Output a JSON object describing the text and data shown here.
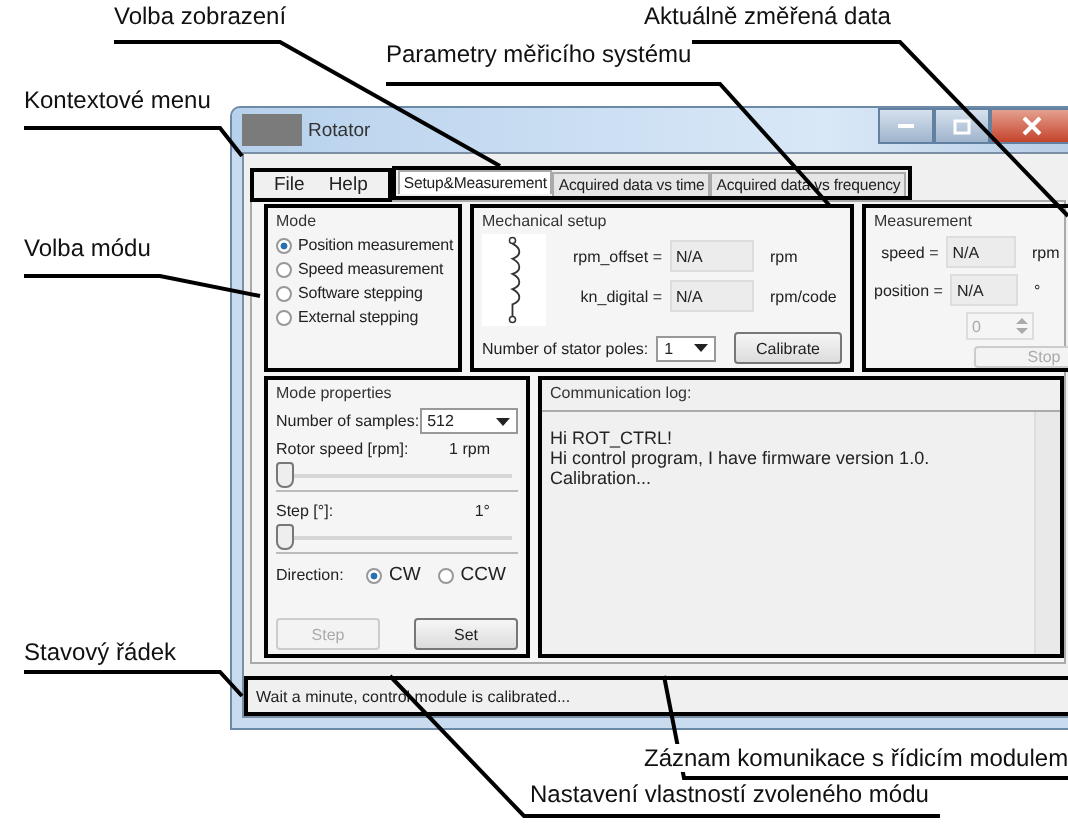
{
  "annotations": [
    {
      "text": "Volba zobrazení"
    },
    {
      "text": "Aktuálně změřená data"
    },
    {
      "text": "Parametry měřicího systému"
    },
    {
      "text": "Kontextové menu"
    },
    {
      "text": "Volba módu"
    },
    {
      "text": "Stavový řádek"
    },
    {
      "text": "Záznam komunikace s řídicím modulem"
    },
    {
      "text": "Nastavení vlastností zvoleného módu"
    }
  ],
  "window": {
    "title": "Rotator"
  },
  "menu": [
    "File",
    "Help"
  ],
  "tabs": [
    {
      "label": "Setup&Measurement",
      "selected": true
    },
    {
      "label": "Acquired data vs time",
      "selected": false
    },
    {
      "label": "Acquired data vs frequency",
      "selected": false
    }
  ],
  "mode": {
    "title": "Mode",
    "options": [
      {
        "label": "Position measurement",
        "selected": true
      },
      {
        "label": "Speed measurement",
        "selected": false
      },
      {
        "label": "Software stepping",
        "selected": false
      },
      {
        "label": "External stepping",
        "selected": false
      }
    ]
  },
  "mechanical": {
    "title": "Mechanical setup",
    "fields": [
      {
        "label": "rpm_offset =",
        "value": "N/A",
        "unit": "rpm"
      },
      {
        "label": "kn_digital =",
        "value": "N/A",
        "unit": "rpm/code"
      }
    ],
    "poles_label": "Number of stator poles:",
    "poles_value": "1",
    "button": "Calibrate"
  },
  "measurement": {
    "title": "Measurement",
    "fields": [
      {
        "label": "speed =",
        "value": "N/A",
        "unit": "rpm"
      },
      {
        "label": "position =",
        "value": "N/A",
        "unit": "°"
      }
    ],
    "spinner": "0",
    "button": {
      "label": "Stop",
      "disabled": true
    }
  },
  "mode_properties": {
    "title": "Mode properties",
    "samples_label": "Number of samples:",
    "samples_value": "512",
    "sliders": [
      {
        "label": "Rotor speed [rpm]:",
        "reading": "1 rpm",
        "level": 0
      },
      {
        "label": "Step [°]:",
        "reading": "1°",
        "level": 0
      }
    ],
    "direction_label": "Direction:",
    "directions": [
      {
        "label": "CW",
        "selected": true
      },
      {
        "label": "CCW",
        "selected": false
      }
    ],
    "buttons": [
      {
        "label": "Step",
        "disabled": true
      },
      {
        "label": "Set",
        "disabled": false
      }
    ]
  },
  "log": {
    "title": "Communication log:",
    "lines": [
      "Hi ROT_CTRL!",
      "Hi control program, I have firmware version 1.0.",
      "Calibration..."
    ]
  },
  "status_bar": "Wait a minute, control module is calibrated..."
}
